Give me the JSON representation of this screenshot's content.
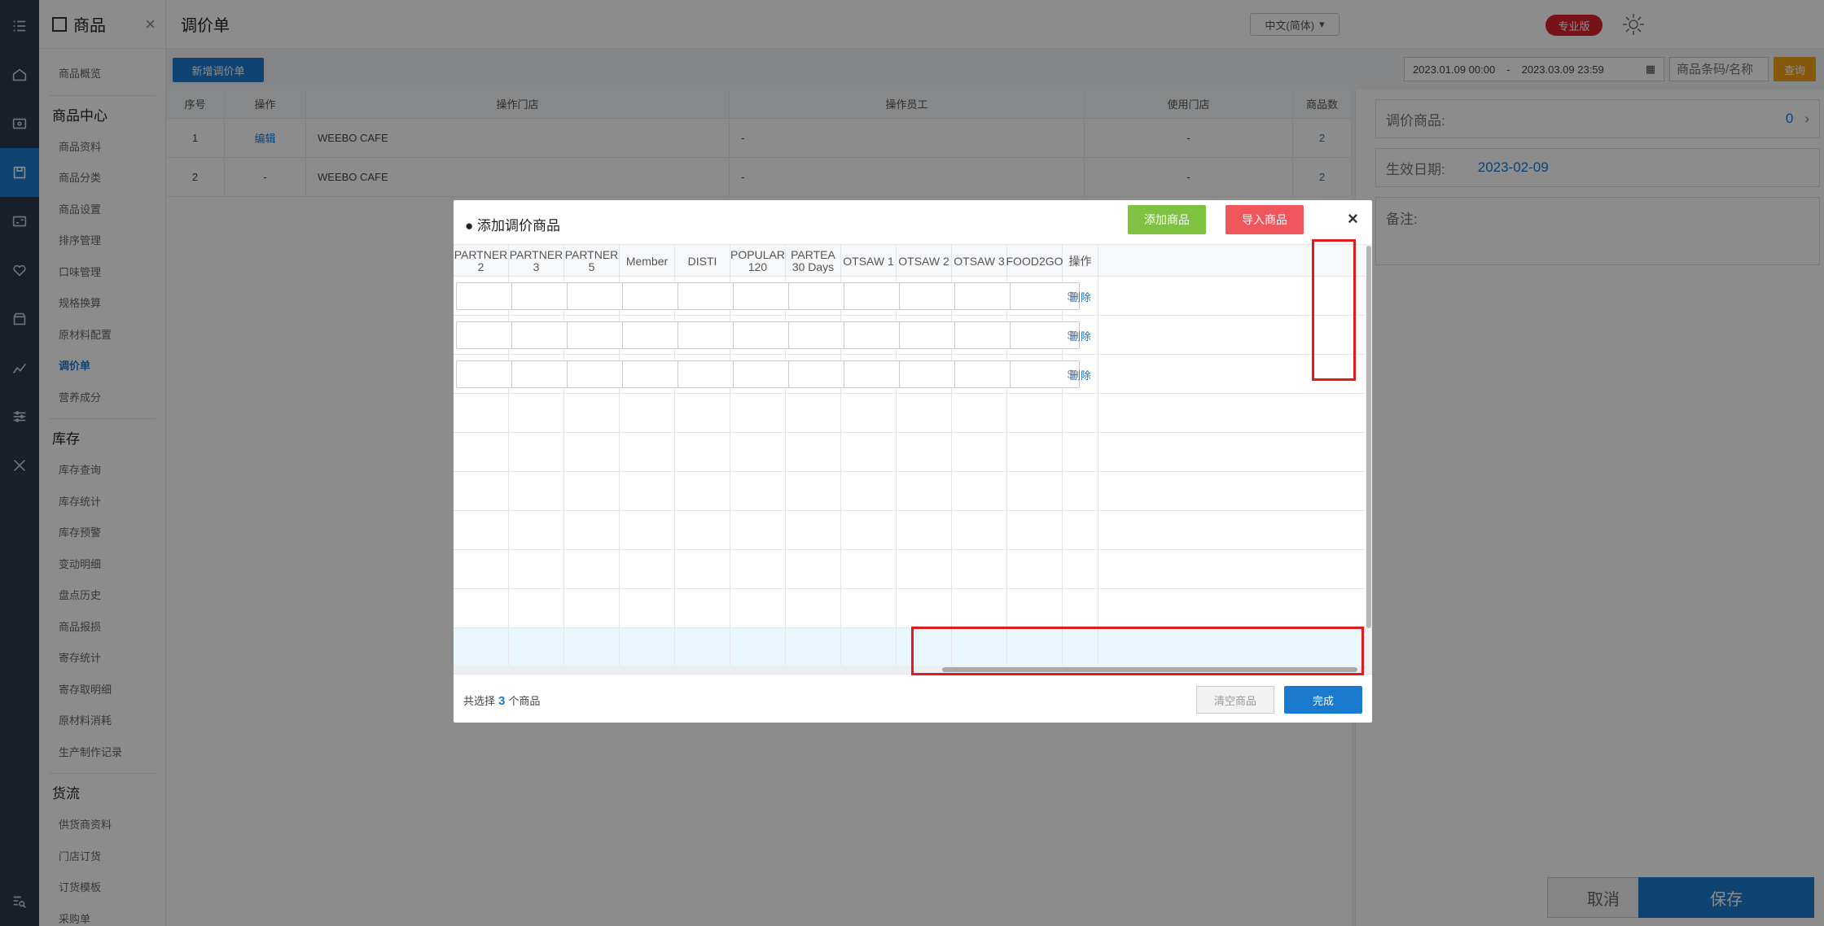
{
  "sidebar": {
    "title": "商品",
    "close": "×",
    "overview": "商品概览",
    "groups": [
      {
        "name": "商品中心",
        "items": [
          "商品资料",
          "商品分类",
          "商品设置",
          "排序管理",
          "口味管理",
          "规格换算",
          "原材料配置",
          "调价单",
          "营养成分"
        ]
      },
      {
        "name": "库存",
        "items": [
          "库存查询",
          "库存统计",
          "库存预警",
          "变动明细",
          "盘点历史",
          "商品报损",
          "寄存统计",
          "寄存取明细",
          "原材料消耗",
          "生产制作记录"
        ]
      },
      {
        "name": "货流",
        "items": [
          "供货商资料",
          "门店订货",
          "订货模板",
          "采购单"
        ]
      }
    ],
    "active_item": "调价单"
  },
  "rail_icons": [
    "list-icon",
    "home-icon",
    "cashier-icon",
    "goods-icon",
    "member-icon",
    "marketing-icon",
    "store-icon",
    "report-icon",
    "settings-icon",
    "tools-icon",
    "search-list-icon"
  ],
  "header": {
    "title": "调价单",
    "language": "中文(简体)",
    "edition_badge": "专业版"
  },
  "toolbar": {
    "new_button": "新增调价单",
    "date_start": "2023.01.09 00:00",
    "date_sep": "-",
    "date_end": "2023.03.09 23:59",
    "search_placeholder": "商品条码/名称",
    "query_button": "查询"
  },
  "list_table": {
    "headers": [
      "序号",
      "操作",
      "操作门店",
      "操作员工",
      "使用门店",
      "商品数"
    ],
    "rows": [
      {
        "index": "1",
        "action": "编辑",
        "store": "WEEBO CAFE",
        "staff": "-",
        "use_store": "-",
        "count": "2"
      },
      {
        "index": "2",
        "action": "-",
        "store": "WEEBO CAFE",
        "staff": "-",
        "use_store": "-",
        "count": "2"
      }
    ]
  },
  "right_panel": {
    "goods_label": "调价商品:",
    "goods_count": "0",
    "effective_label": "生效日期:",
    "effective_date": "2023-02-09",
    "remark_label": "备注:",
    "cancel_button": "取消",
    "save_button": "保存"
  },
  "modal": {
    "title": "● 添加调价商品",
    "add_button": "添加商品",
    "import_button": "导入商品",
    "close": "×",
    "columns": [
      "PARTNER 2",
      "PARTNER 3",
      "PARTNER 5",
      "Member",
      "DISTI",
      "POPULAR 120",
      "PARTEA 30 Days",
      "OTSAW 1",
      "OTSAW 2",
      "OTSAW 3",
      "FOOD2GO",
      "操作"
    ],
    "currency_symbol": "$",
    "delete_label": "删除",
    "footer_prefix": "共选择",
    "selected_count": "3",
    "footer_suffix": "个商品",
    "clear_button": "清空商品",
    "done_button": "完成"
  },
  "colors": {
    "primary": "#1a7ad0",
    "green": "#7fc242",
    "red": "#f0575d",
    "badge": "#d9232d",
    "highlight_box": "#e21a1a"
  }
}
